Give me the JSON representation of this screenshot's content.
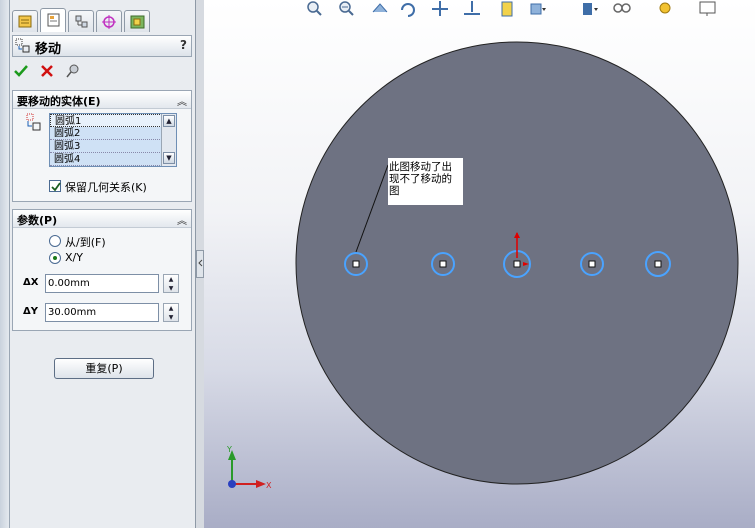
{
  "feature": {
    "title": "移动",
    "help": "?",
    "ok_icon": "check-icon",
    "cancel_icon": "x-icon",
    "pin_icon": "pushpin-icon"
  },
  "tabs": [
    {
      "name": "feature-manager-tab",
      "icon": "feature-tree-icon"
    },
    {
      "name": "property-manager-tab",
      "icon": "property-icon"
    },
    {
      "name": "configuration-manager-tab",
      "icon": "configuration-icon"
    },
    {
      "name": "dimxpert-tab",
      "icon": "crosshair-icon"
    },
    {
      "name": "display-manager-tab",
      "icon": "display-icon"
    }
  ],
  "entities_group": {
    "title": "要移动的实体(E)",
    "items": [
      "圆弧1",
      "圆弧2",
      "圆弧3",
      "圆弧4"
    ],
    "keep_relations_label": "保留几何关系(K)",
    "keep_relations_checked": true
  },
  "params_group": {
    "title": "参数(P)",
    "option_from_to": "从/到(F)",
    "option_xy": "X/Y",
    "selected": "X/Y",
    "dx_label": "ΔX",
    "dx_value": "0.00mm",
    "dy_label": "ΔY",
    "dy_value": "30.00mm"
  },
  "repeat_button": "重复(P)",
  "toolbar_icons": [
    "zoom-to-fit-icon",
    "zoom-area-icon",
    "previous-view-icon",
    "rotate-icon",
    "pan-icon",
    "normal-to-icon",
    "section-view-icon",
    "view-orientation-icon",
    "display-style-icon",
    "hide-show-icon",
    "lighting-icon",
    "monitor-icon"
  ],
  "annotation": {
    "line1": "此图移动了出",
    "line2": "现不了移动的",
    "line3": "图"
  },
  "triad": {
    "x": "X",
    "y": "Y"
  },
  "colors": {
    "disc": "#6e7282",
    "arc": "#4aa3ff",
    "point": "#111111",
    "accent_red": "#e00000",
    "triad_green": "#2a9a2a"
  }
}
